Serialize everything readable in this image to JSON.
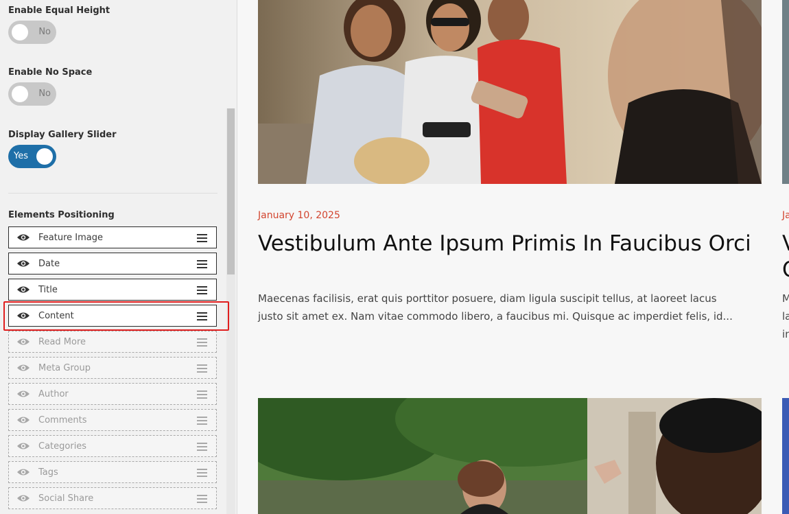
{
  "sidebar": {
    "equal_height": {
      "label": "Enable Equal Height",
      "state": "No"
    },
    "no_space": {
      "label": "Enable No Space",
      "state": "No"
    },
    "gallery_slider": {
      "label": "Display Gallery Slider",
      "state": "Yes"
    },
    "positioning_title": "Elements Positioning",
    "elements": [
      {
        "label": "Feature Image",
        "enabled": true
      },
      {
        "label": "Date",
        "enabled": true
      },
      {
        "label": "Title",
        "enabled": true
      },
      {
        "label": "Content",
        "enabled": true
      },
      {
        "label": "Read More",
        "enabled": false
      },
      {
        "label": "Meta Group",
        "enabled": false
      },
      {
        "label": "Author",
        "enabled": false
      },
      {
        "label": "Comments",
        "enabled": false
      },
      {
        "label": "Categories",
        "enabled": false
      },
      {
        "label": "Tags",
        "enabled": false
      },
      {
        "label": "Social Share",
        "enabled": false
      }
    ]
  },
  "posts": [
    {
      "date": "January 10, 2025",
      "title": "Vestibulum Ante Ipsum Primis In Faucibus Orci",
      "excerpt": "Maecenas facilisis, erat quis porttitor posuere, diam ligula suscipit tellus, at laoreet lacus justo sit amet ex. Nam vitae commodo libero, a faucibus mi. Quisque ac imperdiet felis, id..."
    },
    {
      "date": "Ja",
      "title": "V\nO",
      "excerpt": "M\nla\nin"
    }
  ],
  "colors": {
    "accent_date": "#d2452f",
    "toggle_on": "#1e6fa8",
    "highlight": "#e01e1e"
  }
}
